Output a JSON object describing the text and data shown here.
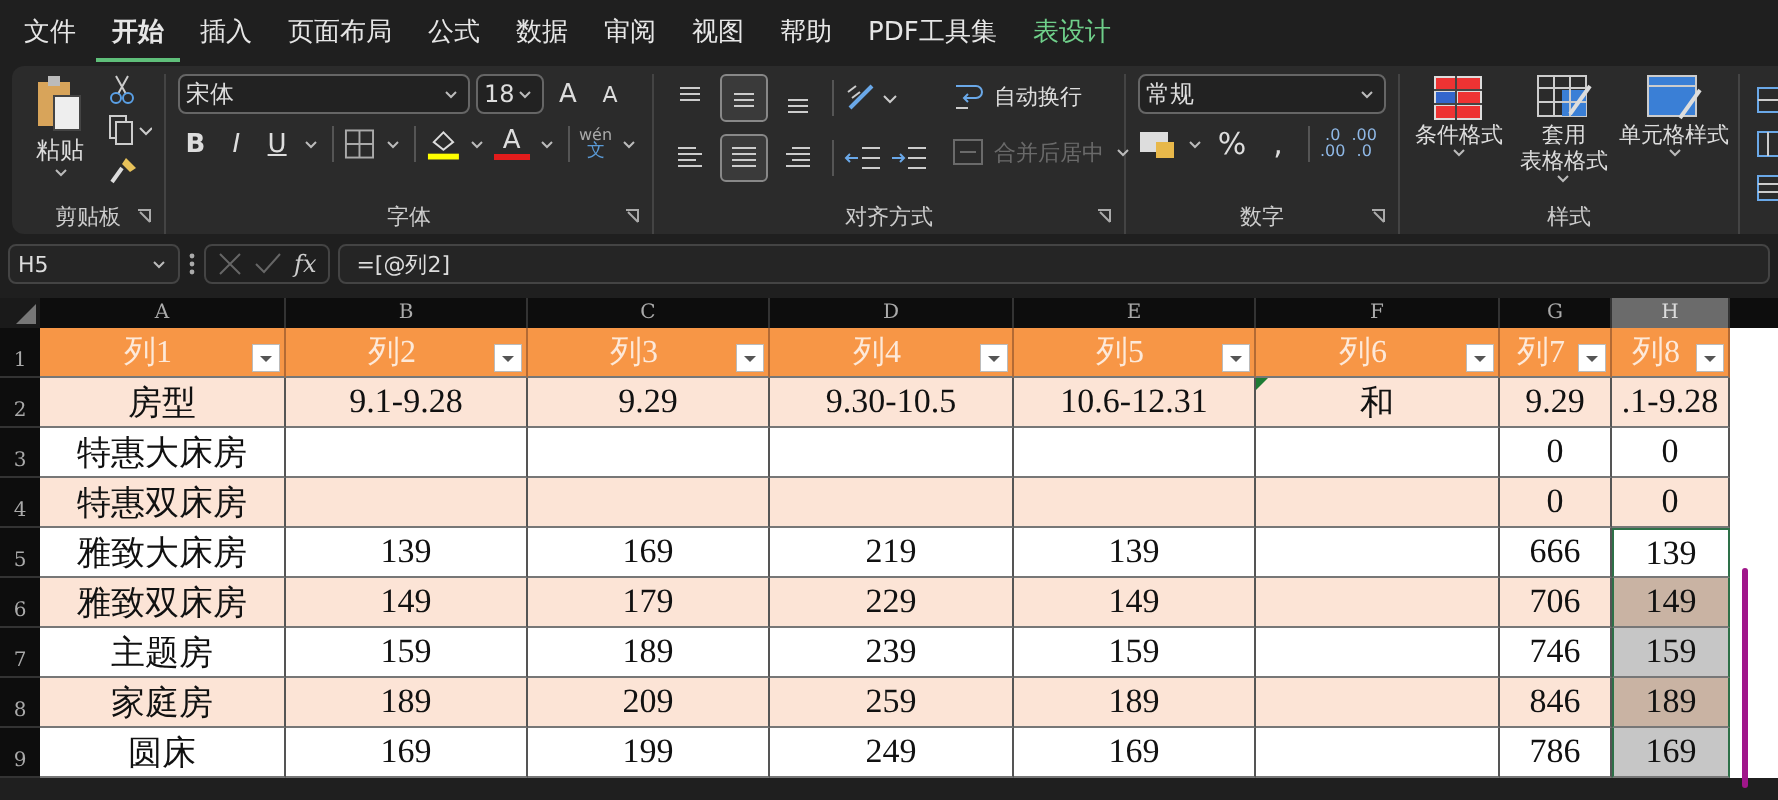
{
  "menu_tabs": [
    {
      "label": "文件",
      "selected": false,
      "kind": "normal"
    },
    {
      "label": "开始",
      "selected": true,
      "kind": "normal"
    },
    {
      "label": "插入",
      "selected": false,
      "kind": "normal"
    },
    {
      "label": "页面布局",
      "selected": false,
      "kind": "normal"
    },
    {
      "label": "公式",
      "selected": false,
      "kind": "normal"
    },
    {
      "label": "数据",
      "selected": false,
      "kind": "normal"
    },
    {
      "label": "审阅",
      "selected": false,
      "kind": "normal"
    },
    {
      "label": "视图",
      "selected": false,
      "kind": "normal"
    },
    {
      "label": "帮助",
      "selected": false,
      "kind": "normal"
    },
    {
      "label": "PDF工具集",
      "selected": false,
      "kind": "normal"
    },
    {
      "label": "表设计",
      "selected": false,
      "kind": "contextual"
    }
  ],
  "ribbon": {
    "clipboard": {
      "paste": "粘贴",
      "title": "剪贴板"
    },
    "font": {
      "name": "宋体",
      "size": "18",
      "grow": "A",
      "shrink": "A",
      "styles": [
        "B",
        "I",
        "U"
      ],
      "font_color": "A",
      "phonetic_top": "wén",
      "phonetic_bottom": "文",
      "title": "字体"
    },
    "alignment": {
      "vertical": [
        {
          "selected": false
        },
        {
          "selected": true
        },
        {
          "selected": false
        }
      ],
      "horizontal": [
        {
          "selected": false
        },
        {
          "selected": true
        },
        {
          "selected": false
        }
      ],
      "wrap": "自动换行",
      "merge": {
        "label": "合并后居中",
        "disabled": true
      },
      "title": "对齐方式"
    },
    "number": {
      "format": "常规",
      "percent": "%",
      "comma": ",",
      "decimals": [
        {
          "top": ".0",
          "bottom": ".00"
        },
        {
          "top": ".00",
          "bottom": ".0"
        }
      ],
      "title": "数字"
    },
    "styles": {
      "buttons": [
        {
          "lines": [
            "条件格式"
          ],
          "kind": "conditional"
        },
        {
          "lines": [
            "套用",
            "表格格式"
          ],
          "kind": "table"
        },
        {
          "lines": [
            "单元格样式"
          ],
          "kind": "cell"
        }
      ],
      "title": "样式"
    }
  },
  "formula_bar": {
    "name_box": "H5",
    "fx": "fx",
    "formula": "=[@列2]"
  },
  "sheet": {
    "columns": [
      {
        "letter": "A",
        "selected": false
      },
      {
        "letter": "B",
        "selected": false
      },
      {
        "letter": "C",
        "selected": false
      },
      {
        "letter": "D",
        "selected": false
      },
      {
        "letter": "E",
        "selected": false
      },
      {
        "letter": "F",
        "selected": false
      },
      {
        "letter": "G",
        "selected": false
      },
      {
        "letter": "H",
        "selected": true
      }
    ],
    "rows": [
      {
        "number": "1",
        "kind": "header",
        "selected": false,
        "active": false,
        "cells": [
          {
            "text": "列1",
            "filter": true
          },
          {
            "text": "列2",
            "filter": true
          },
          {
            "text": "列3",
            "filter": true
          },
          {
            "text": "列4",
            "filter": true
          },
          {
            "text": "列5",
            "filter": true
          },
          {
            "text": "列6",
            "filter": true
          },
          {
            "text": "列7",
            "filter": true
          },
          {
            "text": "列8",
            "filter": true
          }
        ]
      },
      {
        "number": "2",
        "kind": "band",
        "selected": false,
        "active": false,
        "cells": [
          {
            "text": "房型"
          },
          {
            "text": "9.1-9.28"
          },
          {
            "text": "9.29"
          },
          {
            "text": "9.30-10.5"
          },
          {
            "text": "10.6-12.31"
          },
          {
            "text": "和",
            "error": true
          },
          {
            "text": "9.29"
          },
          {
            "text": ".1-9.28"
          }
        ]
      },
      {
        "number": "3",
        "kind": "plain",
        "selected": false,
        "active": false,
        "cells": [
          {
            "text": "特惠大床房"
          },
          {},
          {},
          {},
          {},
          {},
          {
            "text": "0"
          },
          {
            "text": "0"
          }
        ]
      },
      {
        "number": "4",
        "kind": "band",
        "selected": false,
        "active": false,
        "cells": [
          {
            "text": "特惠双床房"
          },
          {},
          {},
          {},
          {},
          {},
          {
            "text": "0"
          },
          {
            "text": "0"
          }
        ]
      },
      {
        "number": "5",
        "kind": "plain",
        "selected": true,
        "active": true,
        "cells": [
          {
            "text": "雅致大床房"
          },
          {
            "text": "139"
          },
          {
            "text": "169"
          },
          {
            "text": "219"
          },
          {
            "text": "139"
          },
          {},
          {
            "text": "666"
          },
          {
            "text": "139"
          }
        ]
      },
      {
        "number": "6",
        "kind": "band",
        "selected": true,
        "active": false,
        "cells": [
          {
            "text": "雅致双床房"
          },
          {
            "text": "149"
          },
          {
            "text": "179"
          },
          {
            "text": "229"
          },
          {
            "text": "149"
          },
          {},
          {
            "text": "706"
          },
          {
            "text": "149"
          }
        ]
      },
      {
        "number": "7",
        "kind": "plain",
        "selected": true,
        "active": false,
        "cells": [
          {
            "text": "主题房"
          },
          {
            "text": "159"
          },
          {
            "text": "189"
          },
          {
            "text": "239"
          },
          {
            "text": "159"
          },
          {},
          {
            "text": "746"
          },
          {
            "text": "159"
          }
        ]
      },
      {
        "number": "8",
        "kind": "band",
        "selected": true,
        "active": false,
        "cells": [
          {
            "text": "家庭房"
          },
          {
            "text": "189"
          },
          {
            "text": "209"
          },
          {
            "text": "259"
          },
          {
            "text": "189"
          },
          {},
          {
            "text": "846"
          },
          {
            "text": "189"
          }
        ]
      },
      {
        "number": "9",
        "kind": "plain",
        "selected": true,
        "active": false,
        "cells": [
          {
            "text": "圆床"
          },
          {
            "text": "169"
          },
          {
            "text": "199"
          },
          {
            "text": "249"
          },
          {
            "text": "169"
          },
          {},
          {
            "text": "786"
          },
          {
            "text": "169"
          }
        ]
      }
    ]
  }
}
